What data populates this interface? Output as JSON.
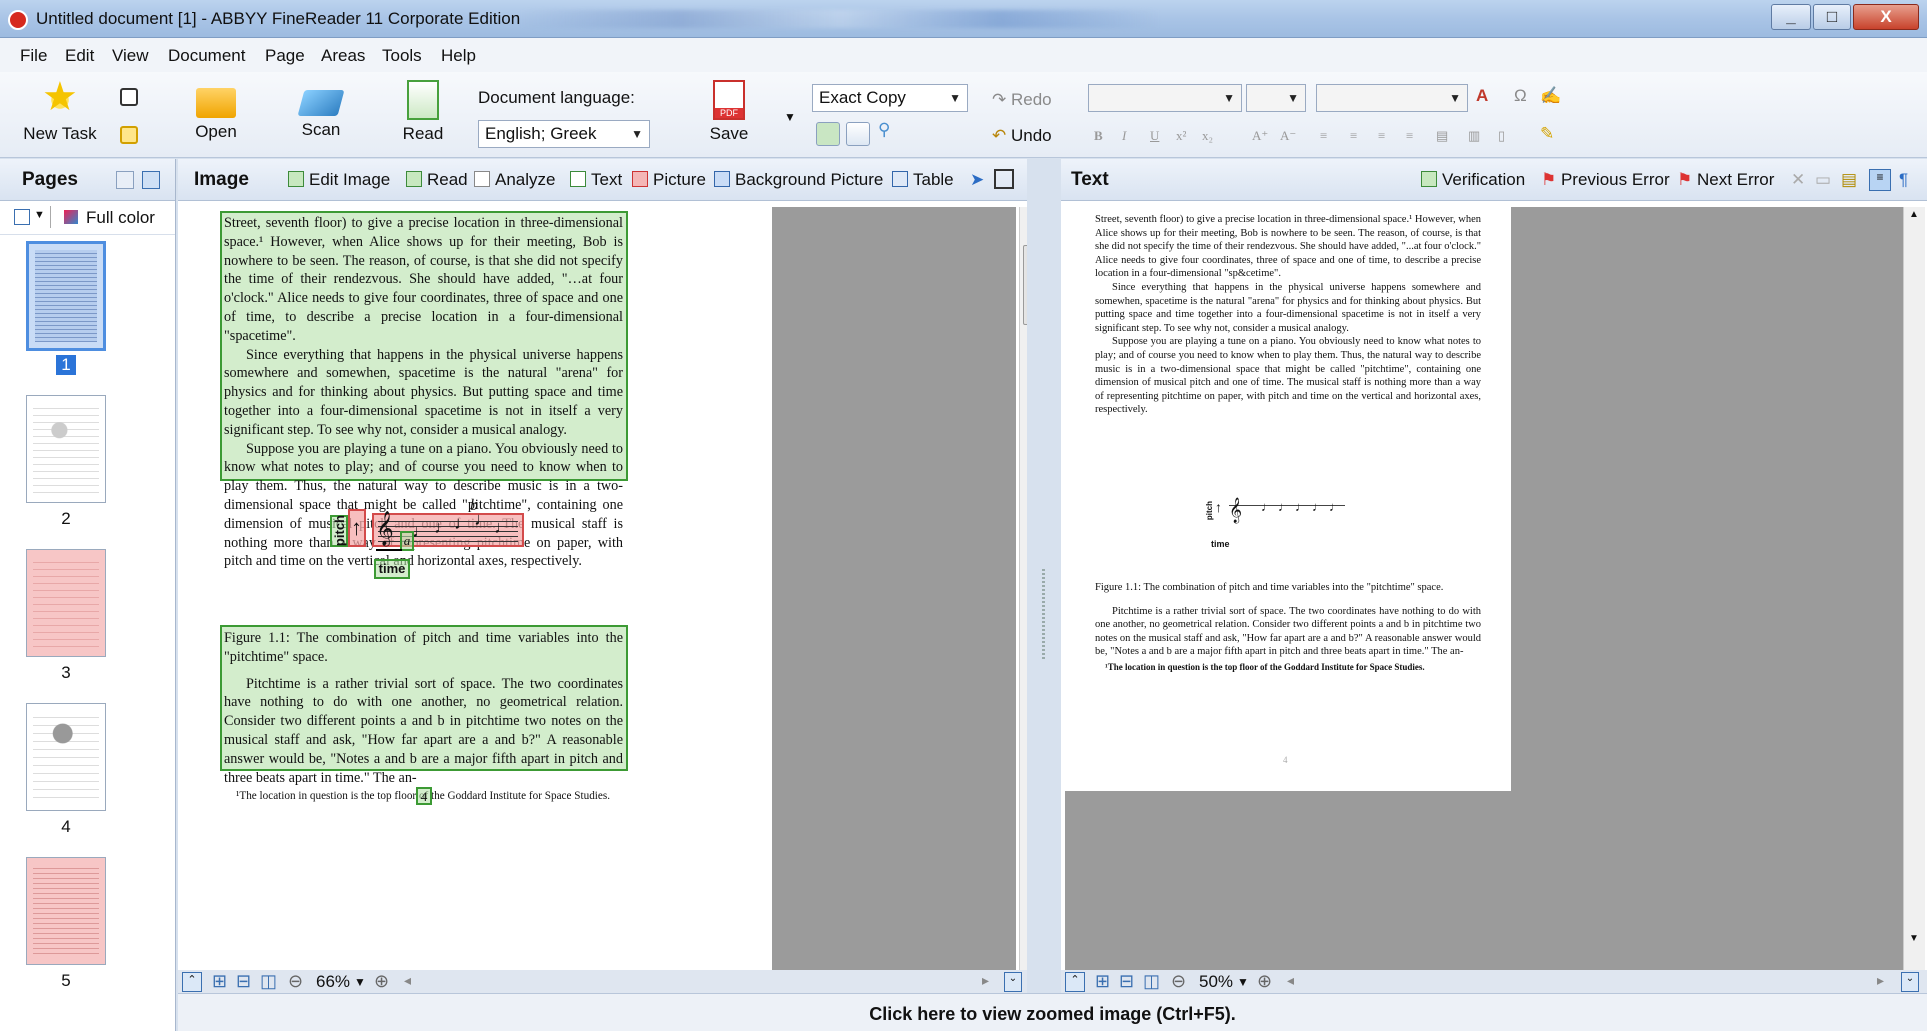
{
  "window": {
    "title": "Untitled document [1] - ABBYY FineReader 11 Corporate Edition",
    "minimize": "_",
    "maximize": "□",
    "close": "X"
  },
  "menu": [
    "File",
    "Edit",
    "View",
    "Document",
    "Page",
    "Areas",
    "Tools",
    "Help"
  ],
  "toolbar": {
    "new_task": "New Task",
    "open": "Open",
    "scan": "Scan",
    "read": "Read",
    "document_language_label": "Document language:",
    "document_language_value": "English; Greek",
    "save": "Save",
    "save_format": "Exact Copy",
    "redo": "Redo",
    "undo": "Undo"
  },
  "pages_panel": {
    "title": "Pages",
    "color_mode": "Full color",
    "pages": [
      "1",
      "2",
      "3",
      "4",
      "5"
    ],
    "selected_page": "1"
  },
  "image_panel": {
    "title": "Image",
    "buttons": [
      "Edit Image",
      "Read",
      "Analyze",
      "Text",
      "Picture",
      "Background Picture",
      "Table"
    ],
    "zoom": "66%",
    "page_number": "4"
  },
  "document": {
    "paragraphs": [
      "Street, seventh floor) to give a precise location in three-dimensional space.¹ However, when Alice shows up for their meeting, Bob is nowhere to be seen. The reason, of course, is that she did not specify the time of their rendezvous. She should have added, \"…at four o'clock.\" Alice needs to give four coordinates, three of space and one of time, to describe a precise location in a four-dimensional \"spacetime\".",
      "Since everything that happens in the physical universe happens somewhere and somewhen, spacetime is the natural \"arena\" for physics and for thinking about physics. But putting space and time together into a four-dimensional spacetime is not in itself a very significant step. To see why not, consider a musical analogy.",
      "Suppose you are playing a tune on a piano. You obviously need to know what notes to play; and of course you need to know when to play them. Thus, the natural way to describe music is in a two-dimensional space that might be called \"pitchtime\", containing one dimension of musical pitch and one of time. The musical staff is nothing more than a way of representing pitchtime on paper, with pitch and time on the vertical and horizontal axes, respectively."
    ],
    "figure_pitch": "pitch",
    "figure_time": "time",
    "figure_a": "a",
    "figure_b": "b",
    "caption": "Figure 1.1: The combination of pitch and time variables into the \"pitchtime\" space.",
    "paragraph_after": "Pitchtime is a rather trivial sort of space. The two coordinates have nothing to do with one another, no geometrical relation. Consider two different points a and b in pitchtime two notes on the musical staff and ask, \"How far apart are a and b?\" A reasonable answer would be, \"Notes a and b are a major fifth apart in pitch and three beats apart in time.\" The an-",
    "footnote": "¹The location in question is the top floor of the Goddard Institute for Space Studies."
  },
  "text_panel": {
    "title": "Text",
    "verification": "Verification",
    "previous_error": "Previous Error",
    "next_error": "Next Error",
    "zoom": "50%",
    "page_number": "4",
    "recognized_first_paragraph": "Street, seventh floor) to give a precise location in three-dimensional space.¹ However, when Alice shows up for their meeting, Bob is nowhere to be seen. The reason, of course, is that she did not specify the time of their rendezvous. She should have added, \"...at four o'clock.\" Alice needs to give four coordinates, three of space and one of time, to describe a precise location in a four-dimensional \"sp&cetime\"."
  },
  "status": {
    "message": "Click here to view zoomed image (Ctrl+F5)."
  },
  "colors": {
    "green_block": "#3c9a34",
    "red_block": "#d34b4b",
    "verification_highlight": "#aeeaf2"
  }
}
